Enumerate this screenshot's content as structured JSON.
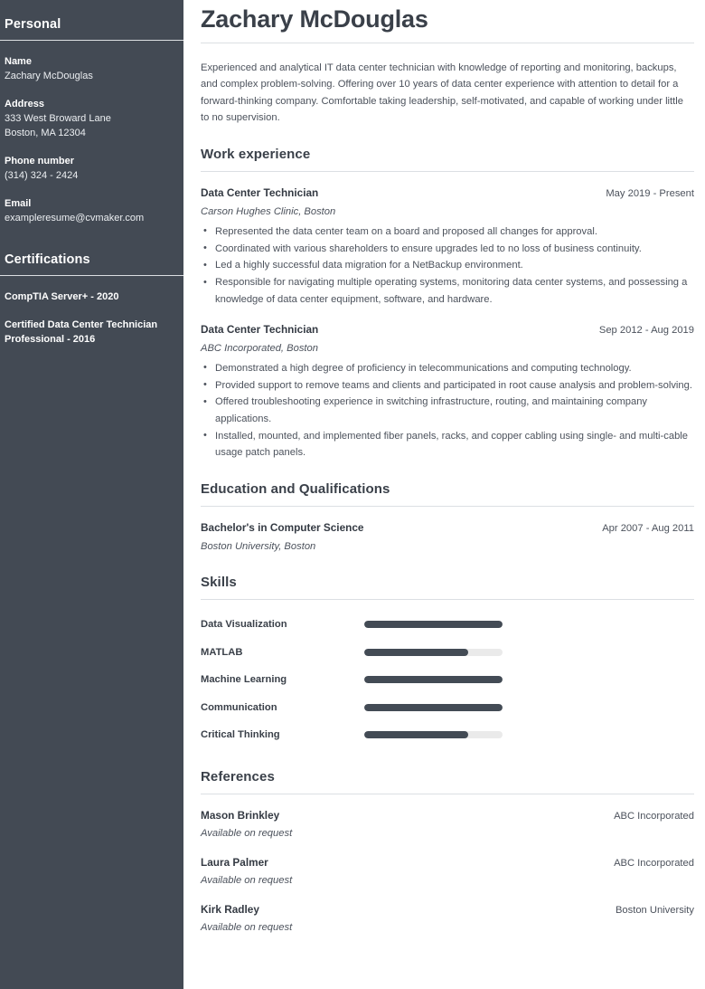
{
  "sidebar": {
    "personal": {
      "heading": "Personal",
      "fields": [
        {
          "label": "Name",
          "value": "Zachary McDouglas"
        },
        {
          "label": "Address",
          "value": "333 West Broward Lane\nBoston, MA 12304"
        },
        {
          "label": "Phone number",
          "value": "(314) 324 - 2424"
        },
        {
          "label": "Email",
          "value": "exampleresume@cvmaker.com"
        }
      ]
    },
    "certifications": {
      "heading": "Certifications",
      "items": [
        "CompTIA Server+ - 2020",
        "Certified Data Center Technician Professional - 2016"
      ]
    },
    "background_color": "#434a54"
  },
  "main": {
    "name": "Zachary McDouglas",
    "summary": "Experienced and analytical IT data center technician with knowledge of reporting and monitoring, backups, and complex problem-solving. Offering over 10 years of data center experience with attention to detail for a forward-thinking company. Comfortable taking leadership, self-motivated, and capable of working under little to no supervision.",
    "work": {
      "heading": "Work experience",
      "entries": [
        {
          "title": "Data Center Technician",
          "date": "May 2019 - Present",
          "subtitle": "Carson Hughes Clinic, Boston",
          "bullets": [
            "Represented the data center team on a board and proposed all changes for approval.",
            "Coordinated with various shareholders to ensure upgrades led to no loss of business continuity.",
            "Led a highly successful data migration for a NetBackup environment.",
            "Responsible for navigating multiple operating systems, monitoring data center systems, and possessing a knowledge of data center equipment, software, and hardware."
          ]
        },
        {
          "title": "Data Center Technician",
          "date": "Sep 2012 - Aug 2019",
          "subtitle": "ABC Incorporated, Boston",
          "bullets": [
            "Demonstrated a high degree of proficiency in telecommunications and computing technology.",
            "Provided support to remove teams and clients and participated in root cause analysis and problem-solving.",
            "Offered troubleshooting experience in switching infrastructure, routing, and maintaining company applications.",
            "Installed, mounted, and implemented fiber panels, racks, and copper cabling using single- and multi-cable usage patch panels."
          ]
        }
      ]
    },
    "education": {
      "heading": "Education and Qualifications",
      "entries": [
        {
          "title": "Bachelor's in Computer Science",
          "date": "Apr 2007 - Aug 2011",
          "subtitle": "Boston University, Boston"
        }
      ]
    },
    "skills": {
      "heading": "Skills",
      "items": [
        {
          "name": "Data Visualization",
          "level": 100
        },
        {
          "name": "MATLAB",
          "level": 75
        },
        {
          "name": "Machine Learning",
          "level": 100
        },
        {
          "name": "Communication",
          "level": 100
        },
        {
          "name": "Critical Thinking",
          "level": 75
        }
      ],
      "fill_color": "#434b55",
      "track_color": "#eaeaea"
    },
    "references": {
      "heading": "References",
      "entries": [
        {
          "name": "Mason Brinkley",
          "organization": "ABC Incorporated",
          "note": "Available on request"
        },
        {
          "name": "Laura Palmer",
          "organization": "ABC Incorporated",
          "note": "Available on request"
        },
        {
          "name": "Kirk Radley",
          "organization": "Boston University",
          "note": "Available on request"
        }
      ]
    }
  }
}
